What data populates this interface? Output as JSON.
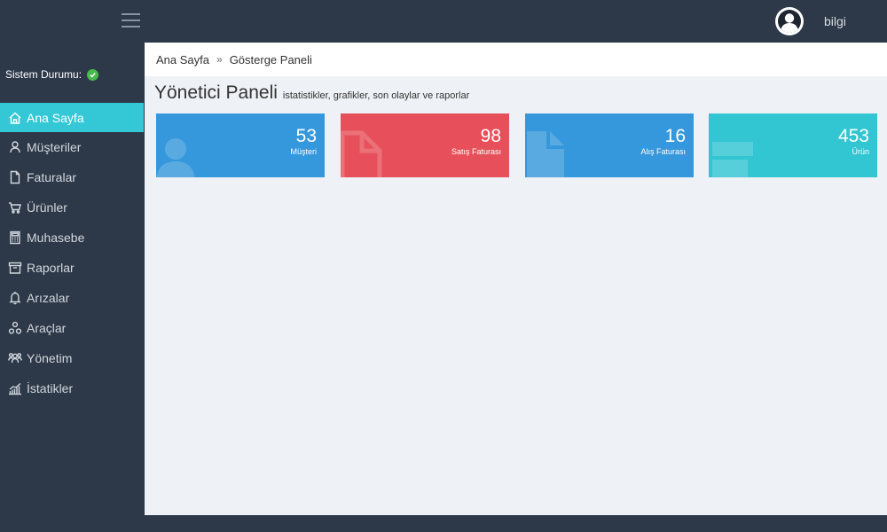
{
  "header": {
    "menu_toggle": "menu-toggle",
    "username": "bilgi"
  },
  "sidebar": {
    "status_label": "Sistem Durumu:",
    "items": [
      {
        "label": "Ana Sayfa",
        "icon": "home-icon"
      },
      {
        "label": "Müşteriler",
        "icon": "user-icon"
      },
      {
        "label": "Faturalar",
        "icon": "document-icon"
      },
      {
        "label": "Ürünler",
        "icon": "cart-icon"
      },
      {
        "label": "Muhasebe",
        "icon": "calculator-icon"
      },
      {
        "label": "Raporlar",
        "icon": "archive-icon"
      },
      {
        "label": "Arızalar",
        "icon": "bell-icon"
      },
      {
        "label": "Araçlar",
        "icon": "tools-icon"
      },
      {
        "label": "Yönetim",
        "icon": "users-icon"
      },
      {
        "label": "İstatikler",
        "icon": "stats-icon"
      }
    ]
  },
  "breadcrumb": {
    "home": "Ana Sayfa",
    "separator": "»",
    "current": "Gösterge Paneli"
  },
  "page": {
    "title": "Yönetici Paneli",
    "subtitle": "istatistikler, grafikler, son olaylar ve raporlar"
  },
  "cards": [
    {
      "value": "53",
      "label": "Müşteri",
      "color": "#3598dc"
    },
    {
      "value": "98",
      "label": "Satış Faturası",
      "color": "#e7505a"
    },
    {
      "value": "16",
      "label": "Alış Faturası",
      "color": "#3598dc"
    },
    {
      "value": "453",
      "label": "Ürün",
      "color": "#32c5d2"
    }
  ],
  "colors": {
    "sidebar_bg": "#2d3848",
    "active_item": "#34c8d7",
    "status_ok": "#48b94b",
    "content_bg": "#eef1f6"
  }
}
